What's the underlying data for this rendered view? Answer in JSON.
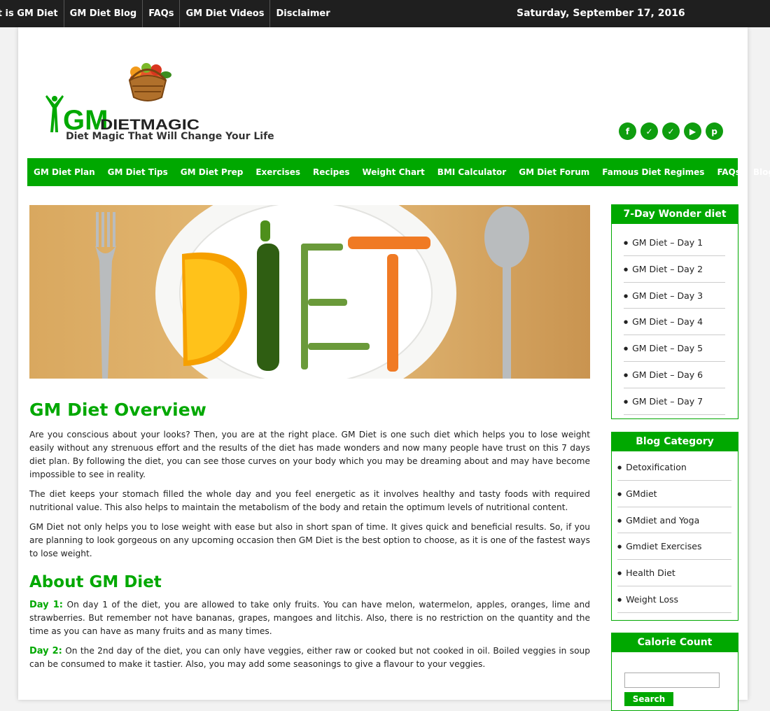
{
  "topbar": {
    "links": [
      "at is GM Diet",
      "GM Diet Blog",
      "FAQs",
      "GM Diet Videos",
      "Disclaimer"
    ],
    "date": "Saturday, September 17, 2016"
  },
  "header": {
    "logo_gm": "GM",
    "logo_text": "DIETMAGIC",
    "tagline": "Diet Magic That Will Change Your Life",
    "social": [
      "facebook-icon",
      "twitter-icon",
      "twitter-icon",
      "youtube-icon",
      "pinterest-icon"
    ]
  },
  "nav": {
    "items": [
      "GM Diet Plan",
      "GM Diet Tips",
      "GM Diet Prep",
      "Exercises",
      "Recipes",
      "Weight Chart",
      "BMI Calculator",
      "GM Diet Forum",
      "Famous Diet Regimes",
      "FAQs",
      "Blog"
    ]
  },
  "main": {
    "overview_title": "GM Diet Overview",
    "overview_paragraphs": [
      "Are you conscious about your looks? Then, you are at the right place. GM Diet is one such diet which helps you to lose weight easily without any strenuous effort and the results of the diet has made wonders and now many people have trust on this 7 days diet plan. By following the diet, you can see those curves on your body which you may be dreaming about and may have become impossible to see in reality.",
      "The diet keeps your stomach filled the whole day and you feel energetic as it involves healthy and tasty foods with required nutritional value. This also helps to maintain the metabolism of the body and retain the optimum levels of nutritional content.",
      "GM Diet not only helps you to lose weight with ease but also in short span of time. It gives quick and beneficial results. So, if you are planning to look gorgeous on any upcoming occasion then GM Diet is the best option to choose, as it is one of the fastest ways to lose weight."
    ],
    "about_title": "About GM Diet",
    "days": [
      {
        "label": "Day 1:",
        "text": "On day 1 of the diet, you are allowed to take only fruits. You can have melon, watermelon, apples, oranges, lime and strawberries. But remember not have bananas, grapes, mangoes and litchis. Also, there is no restriction on the quantity and the time as you can have as many fruits and as many times."
      },
      {
        "label": "Day 2:",
        "text": "On the 2nd day of the diet, you can only have veggies, either raw or cooked but not cooked in oil. Boiled veggies in soup can be consumed to make it tastier. Also, you may add some seasonings to give a flavour to your veggies."
      }
    ]
  },
  "sidebar": {
    "wonder_title": "7-Day Wonder diet",
    "wonder_items": [
      "GM Diet – Day 1",
      "GM Diet – Day 2",
      "GM Diet – Day 3",
      "GM Diet – Day 4",
      "GM Diet – Day 5",
      "GM Diet – Day 6",
      "GM Diet – Day 7"
    ],
    "category_title": "Blog Category",
    "category_items": [
      "Detoxification",
      "GMdiet",
      "GMdiet and Yoga",
      "Gmdiet Exercises",
      "Health Diet",
      "Weight Loss"
    ],
    "calorie_title": "Calorie Count",
    "calorie_button": "Search"
  }
}
